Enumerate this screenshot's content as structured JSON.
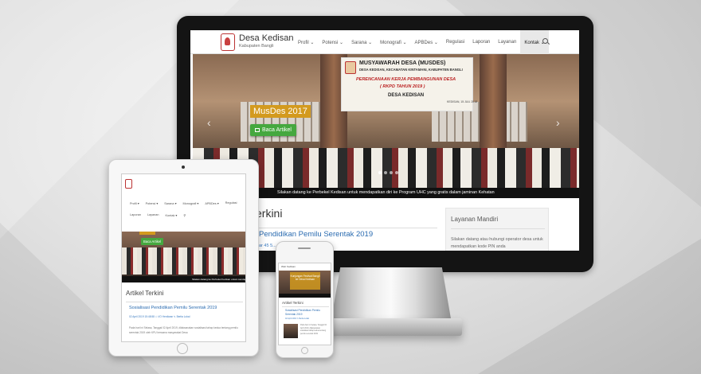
{
  "site": {
    "title": "Desa Kedisan",
    "subtitle": "Kabupaten Bangli"
  },
  "nav": {
    "items": [
      {
        "label": "Profil ⌄"
      },
      {
        "label": "Potensi ⌄"
      },
      {
        "label": "Sarana ⌄"
      },
      {
        "label": "Monografi ⌄"
      },
      {
        "label": "APBDes ⌄"
      },
      {
        "label": "Regulasi"
      },
      {
        "label": "Laporan"
      },
      {
        "label": "Layanan"
      },
      {
        "label": "Kontak ⌄"
      }
    ],
    "active": "Kontak"
  },
  "hero": {
    "banner_line1": "MUSYAWARAH DESA (MUSDES)",
    "banner_line2": "DESA KEDISAN, KECAMATAN KINTAMANI, KABUPATEN BANGLI",
    "banner_line3": "PERENCANAAN KERJA PEMBANGUNAN DESA",
    "banner_line4": "( RKPD TAHUN 2019 )",
    "banner_line5": "DESA KEDISAN",
    "banner_date": "KEDISAN, 15 JULI 2018",
    "slide_title": "MusDes 2017",
    "cta_label": "Baca Artikel",
    "ticker": "Silakan datang ke Perbekel Kedisan untuk mendapatkan diri ke Program UHC yang gratis dalam jaminan Kehatan"
  },
  "content": {
    "heading": "Artikel Terkini",
    "heading_visible": "erkini",
    "post_title": "Sosialisasi Pendidikan Pemilu Serentak 2019",
    "post_title_visible": "Pendidikan Pemilu Serentak 2019",
    "post_meta_visible": "ar 45 5... ta Lokal"
  },
  "sidebar": {
    "title": "Layanan Mandiri",
    "text": "Silakan datang atau hubungi operator desa untuk mendapatkan kode PIN anda"
  },
  "tablet": {
    "menu": [
      "Profil ▾",
      "Potensi ▾",
      "Sarana ▾",
      "Monografi ▾",
      "APBDes ▾",
      "Regulasi",
      "Laporan",
      "Layanan",
      "Kontak ▾"
    ],
    "cta_label": "Baca Artikel",
    "ticker": "Silakan datang ke Perbekel Kedisan untuk mendap",
    "heading": "Artikel Terkini",
    "post_title": "Sosialisasi Pendidikan Pemilu Serentak 2019",
    "post_meta": "02 April 2019 15:48:58   ⚇ I/O Herdiwan   ✎ Berita Lokal",
    "post_body": "Pada hari ini Selasa, Tanggal 02 April 2019, dilaksanakan sosialisasi tahap kedua tentang pemilu serentak 2019 oleh KPU bersama masyarakat Desa"
  },
  "phone": {
    "brand": "Web Kedisan",
    "hero_text": "Kunjungan Festival Bangli ke Desa Kedisan",
    "heading": "Artikel Terkini",
    "post_title": "Sosialisasi Pendidikan Pemilu Serentak 2019",
    "post_meta": "02 April 2019   ✎ Berita Lokal",
    "post_body": "Pada hari ini Selasa, Tanggal 02 April 2019, dilaksanakan sosialisasi tahap kedua tentang pemilu serentak 2019"
  },
  "colors": {
    "link": "#2a6bb0",
    "cta": "#45a83f",
    "slide_title_bg": "#d39a1e",
    "ticker_bg": "#111111"
  }
}
